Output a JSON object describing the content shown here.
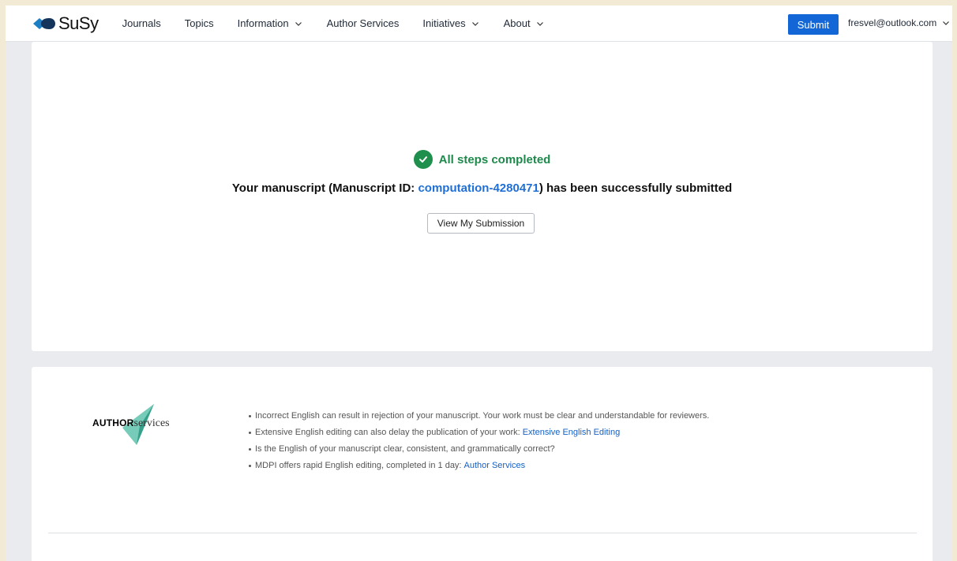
{
  "brand": {
    "name": "SuSy"
  },
  "nav": {
    "items": [
      {
        "label": "Journals",
        "dropdown": false
      },
      {
        "label": "Topics",
        "dropdown": false
      },
      {
        "label": "Information",
        "dropdown": true
      },
      {
        "label": "Author Services",
        "dropdown": false
      },
      {
        "label": "Initiatives",
        "dropdown": true
      },
      {
        "label": "About",
        "dropdown": true
      }
    ],
    "submit_label": "Submit",
    "user_email": "fresvel@outlook.com"
  },
  "success": {
    "status": "All steps completed",
    "message_prefix": "Your manuscript (Manuscript ID: ",
    "manuscript_id": "computation-4280471",
    "message_suffix": ") has been successfully submitted",
    "view_button": "View My Submission"
  },
  "author_services": {
    "logo_bold": "AUTHOR",
    "logo_light": "services",
    "tips": [
      {
        "text": "Incorrect English can result in rejection of your manuscript. Your work must be clear and understandable for reviewers.",
        "link": ""
      },
      {
        "text": "Extensive English editing can also delay the publication of your work:",
        "link": "Extensive English Editing"
      },
      {
        "text": "Is the English of your manuscript clear, consistent, and grammatically correct?",
        "link": ""
      },
      {
        "text": "MDPI offers rapid English editing, completed in 1 day:",
        "link": "Author Services"
      }
    ]
  },
  "colors": {
    "primary": "#1366d6",
    "success": "#1d8a4b",
    "link": "#1560c6"
  }
}
